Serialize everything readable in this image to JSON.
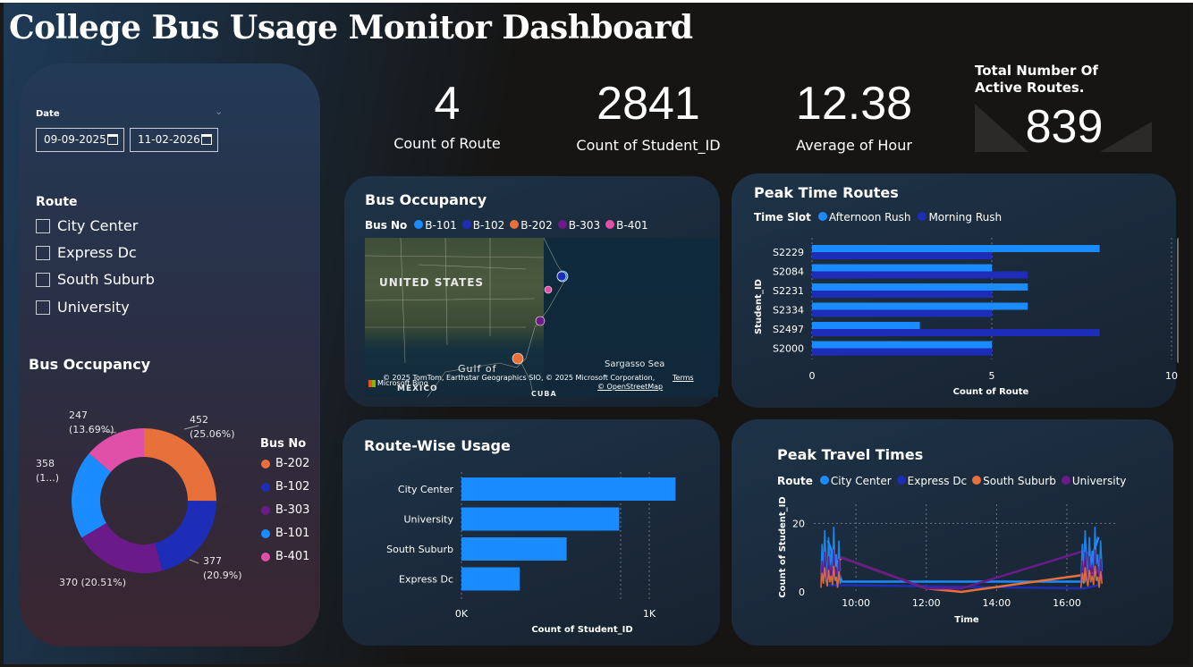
{
  "title": "College Bus Usage Monitor Dashboard",
  "filters": {
    "date_label": "Date",
    "start_date": "09-09-2025",
    "end_date": "11-02-2026",
    "route_label": "Route",
    "routes": [
      "City Center",
      "Express Dc",
      "South Suburb",
      "University"
    ]
  },
  "kpis": [
    {
      "value": "4",
      "label": "Count of Route"
    },
    {
      "value": "2841",
      "label": "Count of Student_ID"
    },
    {
      "value": "12.38",
      "label": "Average of Hour"
    },
    {
      "value": "839",
      "label": "Total Number Of Active Routes."
    }
  ],
  "colors": {
    "B-101": "#1a8cff",
    "B-102": "#1e2db8",
    "B-202": "#e8703a",
    "B-303": "#6b1a8a",
    "B-401": "#e050a8",
    "afternoon": "#1a8cff",
    "morning": "#1e2db8",
    "city_center": "#1a8cff",
    "express_dc": "#1e2db8",
    "south_suburb": "#e8703a",
    "university": "#6b1a8a"
  },
  "donut": {
    "title": "Bus Occupancy",
    "legend_title": "Bus No",
    "legend": [
      "B-202",
      "B-102",
      "B-303",
      "B-101",
      "B-401"
    ],
    "labels": {
      "B-202": "452\n(25.06%)",
      "B-102": "377\n(20.9%)",
      "B-303": "370 (20.51%)",
      "B-101": "358\n(1...)",
      "B-401": "247\n(13.69%)"
    }
  },
  "map": {
    "title": "Bus Occupancy",
    "legend_title": "Bus No",
    "legend": [
      "B-101",
      "B-102",
      "B-202",
      "B-303",
      "B-401"
    ],
    "labels": {
      "us": "UNITED STATES",
      "gulf": "Gulf of",
      "mexico": "MEXICO",
      "sargasso": "Sargasso Sea",
      "cuba": "CUBA",
      "attribution": "© 2025 TomTom, Earthstar Geographics SIO, © 2025 Microsoft Corporation,",
      "terms": "Terms",
      "osm": "© OpenStreetMap",
      "bing": "Microsoft Bing"
    }
  },
  "peak_time": {
    "title": "Peak Time Routes",
    "legend_title": "Time Slot",
    "legend": [
      "Afternoon Rush",
      "Morning Rush"
    ]
  },
  "route_usage": {
    "title": "Route-Wise Usage"
  },
  "peak_travel": {
    "title": "Peak Travel Times",
    "legend_title": "Route",
    "legend": [
      "City Center",
      "Express Dc",
      "South Suburb",
      "University"
    ]
  },
  "chart_data": [
    {
      "type": "pie",
      "title": "Bus Occupancy",
      "categories": [
        "B-202",
        "B-102",
        "B-303",
        "B-101",
        "B-401"
      ],
      "values": [
        452,
        377,
        370,
        358,
        247
      ],
      "percent": [
        25.06,
        20.9,
        20.51,
        19.84,
        13.69
      ]
    },
    {
      "type": "bar",
      "title": "Peak Time Routes",
      "orientation": "horizontal",
      "categories": [
        "S2229",
        "S2084",
        "S2231",
        "S2334",
        "S2497",
        "S2000"
      ],
      "series": [
        {
          "name": "Afternoon Rush",
          "values": [
            8,
            5,
            6,
            6,
            3,
            5
          ]
        },
        {
          "name": "Morning Rush",
          "values": [
            5,
            6,
            5,
            5,
            8,
            5
          ]
        }
      ],
      "xlabel": "Count of Route",
      "ylabel": "Student_ID",
      "xlim": [
        0,
        10
      ],
      "xticks": [
        "0",
        "5",
        "10"
      ]
    },
    {
      "type": "bar",
      "title": "Route-Wise Usage",
      "orientation": "horizontal",
      "categories": [
        "City Center",
        "University",
        "South Suburb",
        "Express Dc"
      ],
      "values": [
        1140,
        840,
        560,
        310
      ],
      "xlabel": "Count of Student_ID",
      "xlim": [
        0,
        1300
      ],
      "xticks": [
        "0K",
        "1K"
      ]
    },
    {
      "type": "line",
      "title": "Peak Travel Times",
      "xlabel": "Time",
      "ylabel": "Count of Student_ID",
      "xticks": [
        "10:00",
        "12:00",
        "14:00",
        "16:00"
      ],
      "yticks": [
        "0",
        "20"
      ],
      "xlim": [
        8.8,
        17.4
      ],
      "ylim": [
        0,
        24
      ],
      "series": [
        {
          "name": "City Center",
          "x": [
            9.2,
            9.6,
            16.5,
            16.9
          ],
          "y": [
            15,
            3,
            3,
            16
          ]
        },
        {
          "name": "Express Dc",
          "x": [
            9.2,
            9.6,
            16.5,
            16.9
          ],
          "y": [
            2,
            2,
            1,
            2
          ]
        },
        {
          "name": "South Suburb",
          "x": [
            9.2,
            9.6,
            12.0,
            13.0,
            16.5,
            16.9
          ],
          "y": [
            6,
            10,
            1,
            0,
            5,
            6
          ]
        },
        {
          "name": "University",
          "x": [
            9.2,
            9.6,
            12.0,
            13.0,
            16.5,
            16.9
          ],
          "y": [
            9,
            10,
            1,
            1,
            12,
            9
          ]
        }
      ]
    }
  ]
}
